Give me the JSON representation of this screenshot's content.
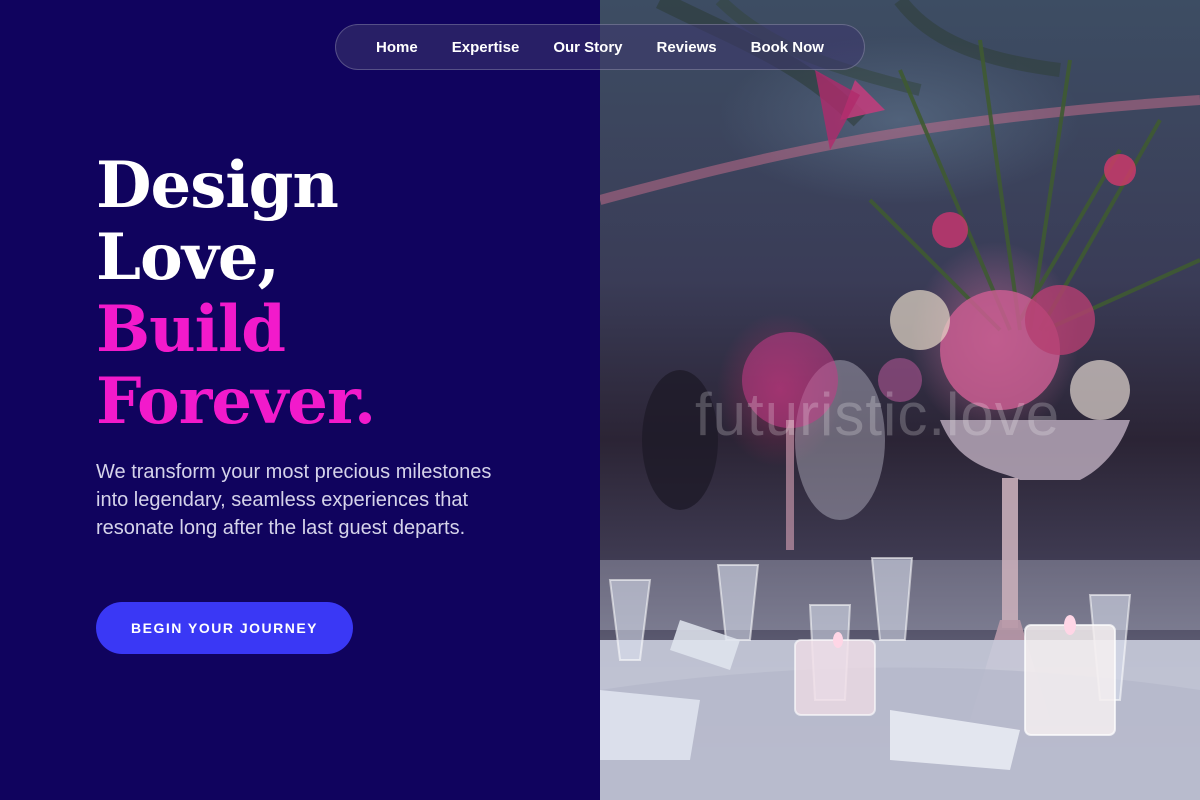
{
  "nav": {
    "items": [
      "Home",
      "Expertise",
      "Our Story",
      "Reviews",
      "Book Now"
    ]
  },
  "hero": {
    "headline_lines": [
      "Design",
      "Love,",
      "Build",
      "Forever."
    ],
    "description": "We transform your most precious milestones into legendary, seamless experiences that resonate long after the last guest departs.",
    "cta_label": "BEGIN YOUR JOURNEY"
  },
  "photo": {
    "watermark": "futuristic.love",
    "subject": "reception-table-centerpiece-photo"
  },
  "colors": {
    "background": "#10035e",
    "accent_pink": "#f21acb",
    "cta": "#3a38f5",
    "text_light": "#d5d3ea"
  }
}
